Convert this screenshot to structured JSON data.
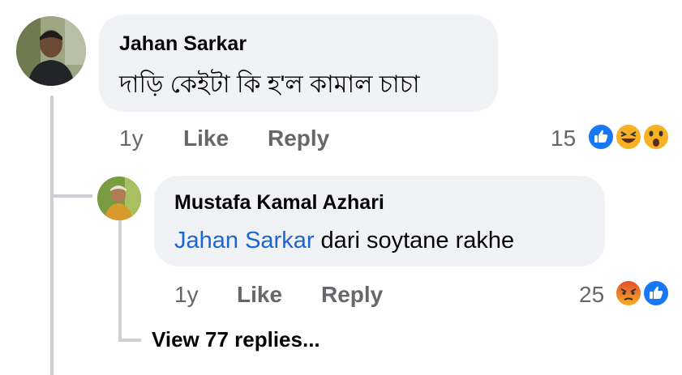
{
  "comment": {
    "author": "Jahan Sarkar",
    "text": "দাড়ি কেইটা কি হ'ল কামাল চাচা",
    "time": "1y",
    "like_label": "Like",
    "reply_label": "Reply",
    "reaction_count": "15",
    "reactions": [
      "like-icon",
      "haha-icon",
      "wow-icon"
    ]
  },
  "reply": {
    "author": "Mustafa Kamal Azhari",
    "mention": "Jahan Sarkar",
    "text": " dari soytane rakhe",
    "time": "1y",
    "like_label": "Like",
    "reply_label": "Reply",
    "reaction_count": "25",
    "reactions": [
      "angry-icon",
      "like-icon"
    ]
  },
  "view_replies_label": "View 77 replies...",
  "colors": {
    "bubble": "#f0f2f5",
    "mention": "#1a66d6",
    "meta": "#65676b",
    "like_blue": "#1877f2",
    "emoji_yellow": "#f7b125",
    "angry_orange": "#e9710f"
  }
}
